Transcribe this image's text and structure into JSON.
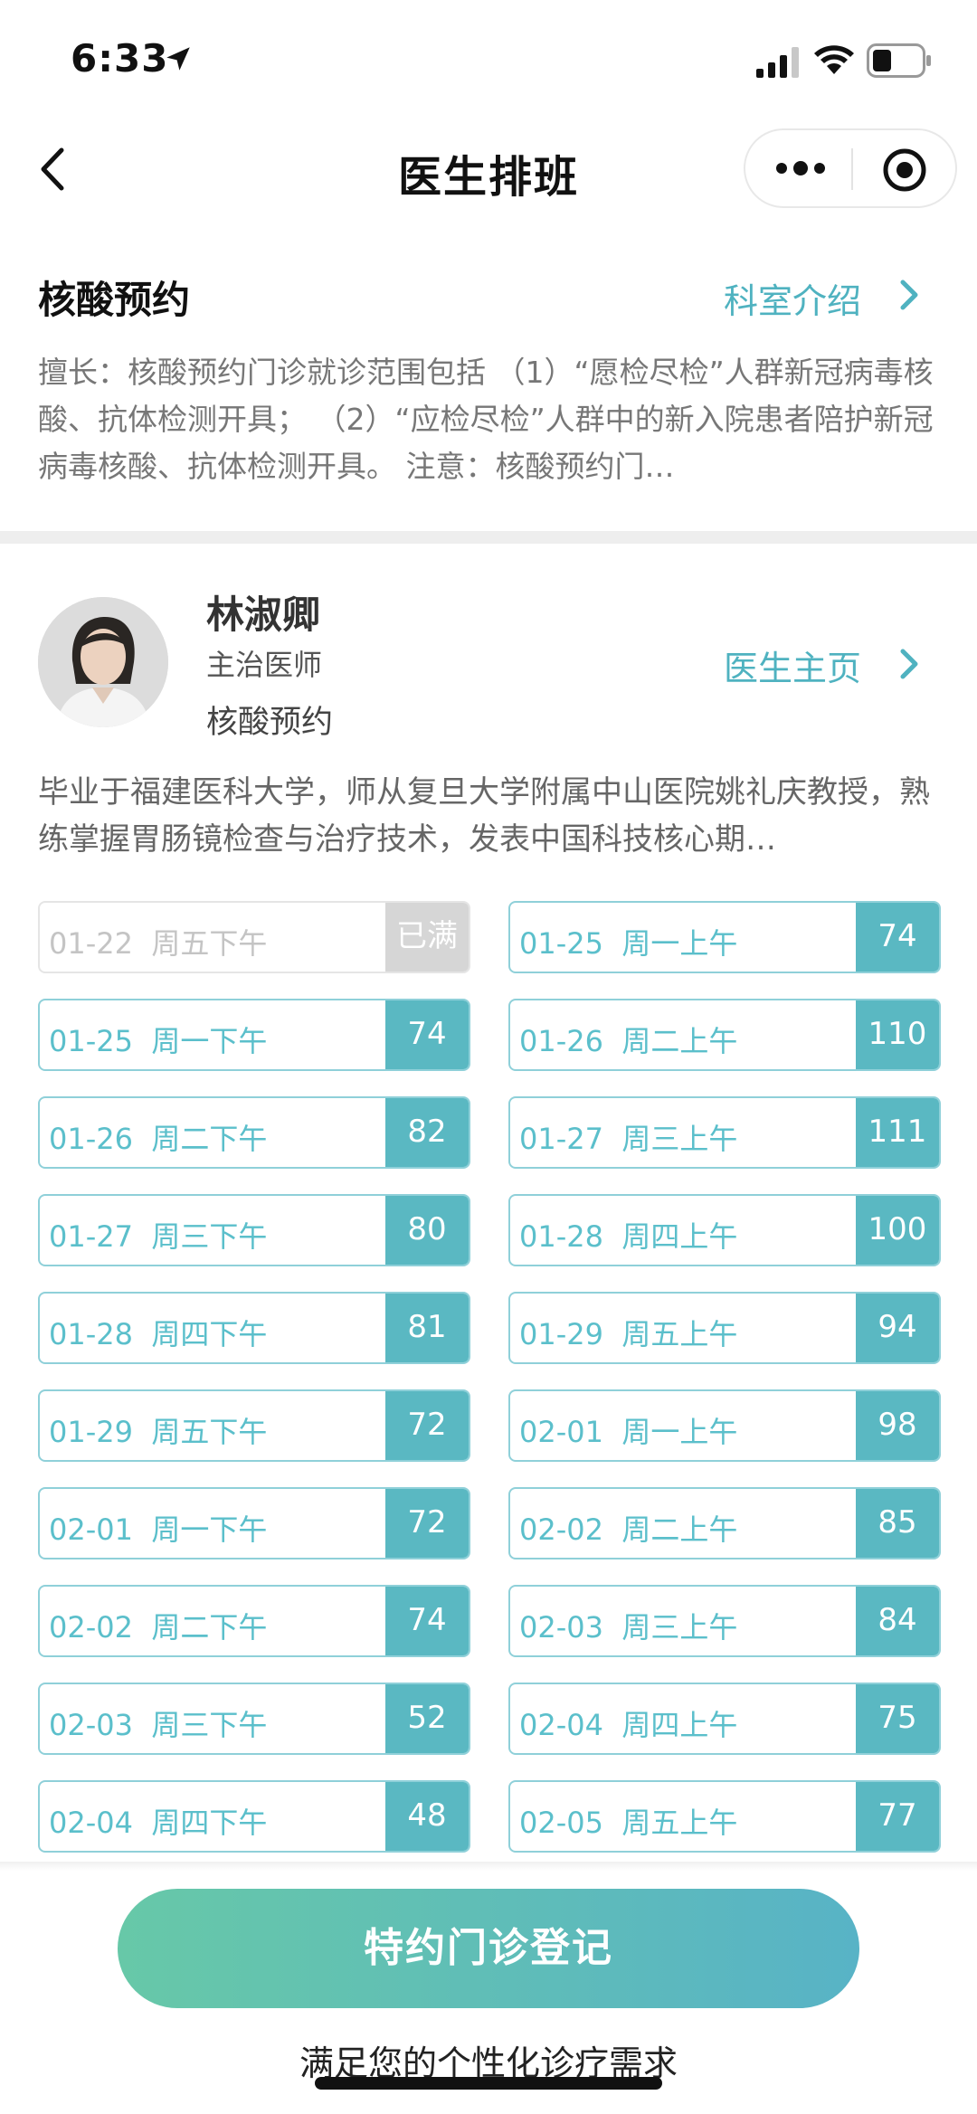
{
  "status_bar": {
    "time": "6:33"
  },
  "nav": {
    "title": "医生排班"
  },
  "department": {
    "name": "核酸预约",
    "link_label": "科室介绍",
    "description": "擅长：核酸预约门诊就诊范围包括 （1）“愿检尽检”人群新冠病毒核酸、抗体检测开具； （2）“应检尽检”人群中的新入院患者陪护新冠病毒核酸、抗体检测开具。 注意：核酸预约门…"
  },
  "doctor": {
    "name": "林淑卿",
    "title": "主治医师",
    "department": "核酸预约",
    "link_label": "医生主页",
    "description": "毕业于福建医科大学，师从复旦大学附属中山医院姚礼庆教授，熟练掌握胃肠镜检查与治疗技术，发表中国科技核心期…"
  },
  "schedule": [
    {
      "date": "01-22",
      "session": "周五下午",
      "count": "已满",
      "full": true
    },
    {
      "date": "01-25",
      "session": "周一上午",
      "count": "74"
    },
    {
      "date": "01-25",
      "session": "周一下午",
      "count": "74"
    },
    {
      "date": "01-26",
      "session": "周二上午",
      "count": "110"
    },
    {
      "date": "01-26",
      "session": "周二下午",
      "count": "82"
    },
    {
      "date": "01-27",
      "session": "周三上午",
      "count": "111"
    },
    {
      "date": "01-27",
      "session": "周三下午",
      "count": "80"
    },
    {
      "date": "01-28",
      "session": "周四上午",
      "count": "100"
    },
    {
      "date": "01-28",
      "session": "周四下午",
      "count": "81"
    },
    {
      "date": "01-29",
      "session": "周五上午",
      "count": "94"
    },
    {
      "date": "01-29",
      "session": "周五下午",
      "count": "72"
    },
    {
      "date": "02-01",
      "session": "周一上午",
      "count": "98"
    },
    {
      "date": "02-01",
      "session": "周一下午",
      "count": "72"
    },
    {
      "date": "02-02",
      "session": "周二上午",
      "count": "85"
    },
    {
      "date": "02-02",
      "session": "周二下午",
      "count": "74"
    },
    {
      "date": "02-03",
      "session": "周三上午",
      "count": "84"
    },
    {
      "date": "02-03",
      "session": "周三下午",
      "count": "52"
    },
    {
      "date": "02-04",
      "session": "周四上午",
      "count": "75"
    },
    {
      "date": "02-04",
      "session": "周四下午",
      "count": "48"
    },
    {
      "date": "02-05",
      "session": "周五上午",
      "count": "77"
    }
  ],
  "cta": {
    "button_label": "特约门诊登记",
    "subtitle": "满足您的个性化诊疗需求"
  },
  "colors": {
    "accent": "#5ab8c2",
    "link": "#4fb2c0",
    "cta_start": "#67c8a8",
    "cta_end": "#58b3c6"
  }
}
